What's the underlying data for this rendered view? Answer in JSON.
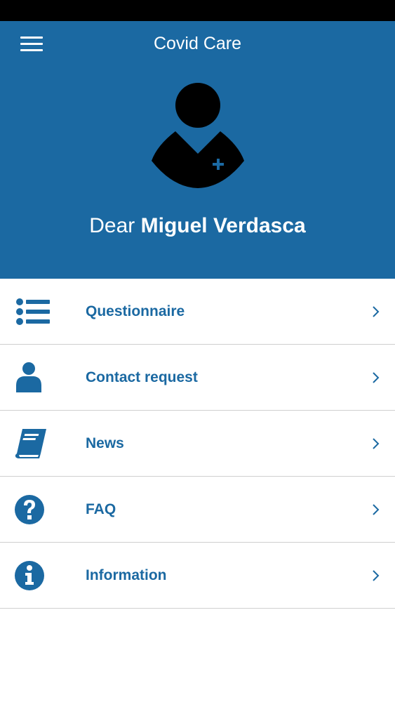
{
  "header": {
    "title": "Covid Care",
    "greeting_prefix": "Dear",
    "user_name": "Miguel Verdasca",
    "menu_icon": "hamburger-menu-icon",
    "avatar_icon": "doctor-avatar-icon"
  },
  "menu": {
    "items": [
      {
        "label": "Questionnaire",
        "icon": "list-icon"
      },
      {
        "label": "Contact request",
        "icon": "person-icon"
      },
      {
        "label": "News",
        "icon": "book-icon"
      },
      {
        "label": "FAQ",
        "icon": "question-circle-icon"
      },
      {
        "label": "Information",
        "icon": "info-circle-icon"
      }
    ]
  },
  "colors": {
    "primary": "#1b69a2",
    "background": "#ffffff",
    "divider": "#cfcfcf",
    "status_bar": "#000000"
  }
}
